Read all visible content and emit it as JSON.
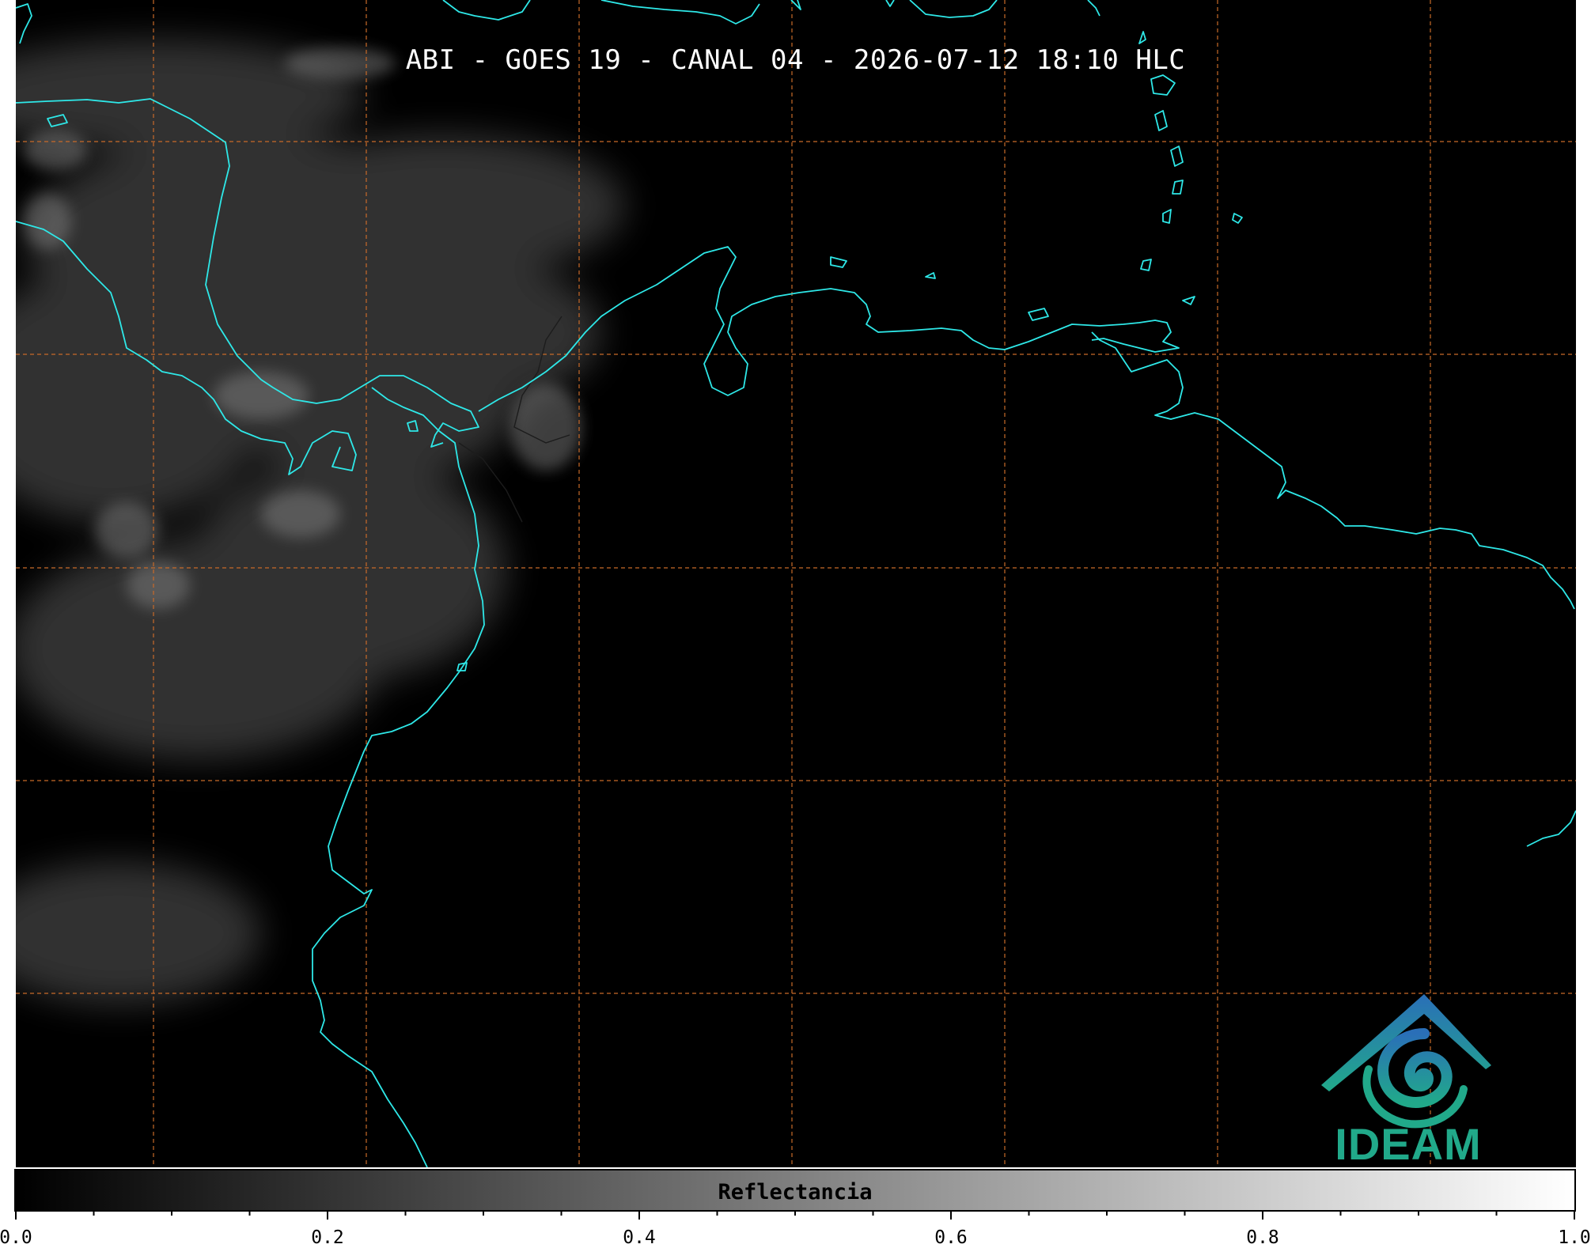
{
  "map": {
    "title": "ABI - GOES 19 - CANAL 04 - 2026-07-12 18:10 HLC",
    "background_color": "#000000",
    "coastline_color": "#2ee8e8",
    "graticule_color": "#c86a28",
    "grid": true
  },
  "logo": {
    "text": "IDEAM",
    "icon": "ideam-mountain-spiral-logo",
    "colors": [
      "#2a6fb8",
      "#21a98a"
    ]
  },
  "colorbar": {
    "label": "Reflectancia",
    "min": 0.0,
    "max": 1.0,
    "gradient_from": "#000000",
    "gradient_to": "#ffffff",
    "tick_labels": [
      "0.0",
      "0.2",
      "0.4",
      "0.6",
      "0.8",
      "1.0"
    ]
  }
}
